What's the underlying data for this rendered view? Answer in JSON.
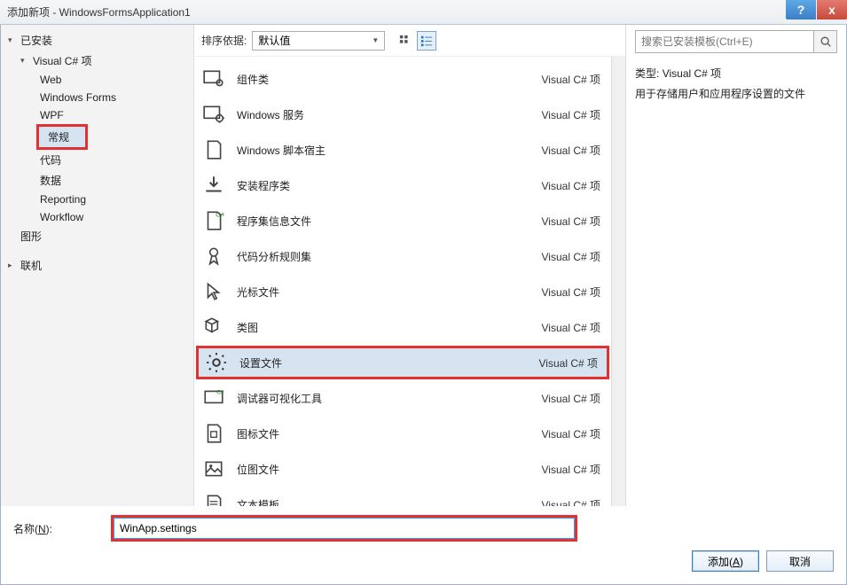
{
  "window": {
    "title": "添加新项 - WindowsFormsApplication1"
  },
  "tree": {
    "installed": "已安装",
    "csharp": "Visual C# 项",
    "children": [
      "Web",
      "Windows Forms",
      "WPF",
      "常规",
      "代码",
      "数据",
      "Reporting",
      "Workflow"
    ],
    "graphics": "图形",
    "online": "联机"
  },
  "toolbar": {
    "sort_label": "排序依据:",
    "sort_value": "默认值"
  },
  "templates": [
    {
      "name": "组件类",
      "cat": "Visual C# 项"
    },
    {
      "name": "Windows 服务",
      "cat": "Visual C# 项"
    },
    {
      "name": "Windows 脚本宿主",
      "cat": "Visual C# 项"
    },
    {
      "name": "安装程序类",
      "cat": "Visual C# 项"
    },
    {
      "name": "程序集信息文件",
      "cat": "Visual C# 项"
    },
    {
      "name": "代码分析规则集",
      "cat": "Visual C# 项"
    },
    {
      "name": "光标文件",
      "cat": "Visual C# 项"
    },
    {
      "name": "类图",
      "cat": "Visual C# 项"
    },
    {
      "name": "设置文件",
      "cat": "Visual C# 项"
    },
    {
      "name": "调试器可视化工具",
      "cat": "Visual C# 项"
    },
    {
      "name": "图标文件",
      "cat": "Visual C# 项"
    },
    {
      "name": "位图文件",
      "cat": "Visual C# 项"
    },
    {
      "name": "文本模板",
      "cat": "Visual C# 项"
    }
  ],
  "right": {
    "search_placeholder": "搜索已安装模板(Ctrl+E)",
    "type_label": "类型:",
    "type_value": "Visual C# 项",
    "desc": "用于存储用户和应用程序设置的文件"
  },
  "bottom": {
    "name_label": "名称(N):",
    "name_value": "WinApp.settings",
    "add": "添加(A)",
    "cancel": "取消"
  }
}
